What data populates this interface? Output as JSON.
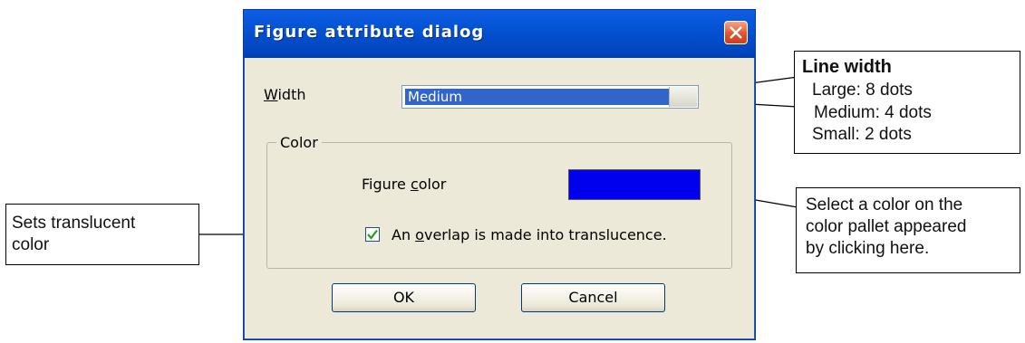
{
  "dialog": {
    "title": "Figure attribute dialog",
    "width_label_prefix": "W",
    "width_label_rest": "idth",
    "width_value": "Medium",
    "color_group_label": "Color",
    "figure_color_label_pre": "Figure ",
    "figure_color_label_ul": "c",
    "figure_color_label_post": "olor",
    "figure_color_value": "#0000ee",
    "translucent_checked": true,
    "translucent_label_pre": "An ",
    "translucent_label_ul": "o",
    "translucent_label_post": "verlap is made into translucence.",
    "ok_label": "OK",
    "cancel_label": "Cancel"
  },
  "callouts": {
    "line_width": {
      "title": "Line width",
      "lines": [
        "Large: 8 dots",
        "Medium: 4 dots",
        "Small: 2 dots"
      ]
    },
    "color_select": {
      "lines": [
        "Select a color on the",
        "color pallet appeared",
        "by clicking here."
      ]
    },
    "translucent": {
      "lines": [
        "Sets translucent",
        "color"
      ]
    }
  }
}
